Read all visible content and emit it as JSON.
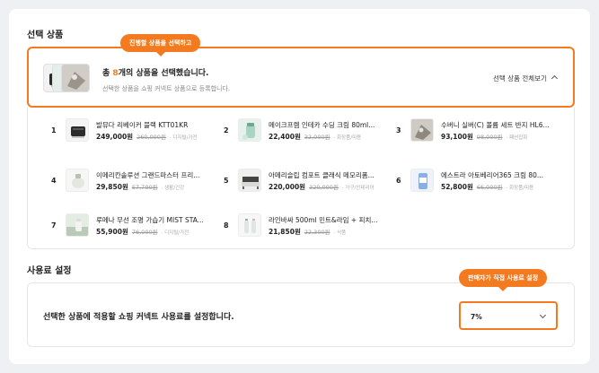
{
  "selected_products": {
    "section_title": "선택 상품",
    "tooltip": "진행할 상품을 선택하고",
    "summary_prefix": "총 ",
    "summary_count": "8",
    "summary_suffix": "개의 상품을 선택했습니다.",
    "summary_sub": "선택한 상품을 쇼핑 커넥트 상품으로 등록합니다.",
    "view_all": "선택 상품 전체보기",
    "products": [
      {
        "index": "1",
        "name": "발뮤다 리베이커 블랙 KTT01KR",
        "price": "249,000원",
        "original": "260,000원",
        "category": "디지털/가전"
      },
      {
        "index": "2",
        "name": "메이크프렘 인테카 수딩 크림 80ml...",
        "price": "22,400원",
        "original": "32,000원",
        "category": "화장품/미용"
      },
      {
        "index": "3",
        "name": "수버니 실버(C) 볼륨 세트 반지 HL6...",
        "price": "93,100원",
        "original": "98,000원",
        "category": "패션잡화"
      },
      {
        "index": "4",
        "name": "이메리칸솔루션 그랜드마스터 프리...",
        "price": "29,850원",
        "original": "57,700원",
        "category": "생활/건강"
      },
      {
        "index": "5",
        "name": "아메리슬립 컴포트 클래식 메모리폼...",
        "price": "220,000원",
        "original": "320,000원",
        "category": "가구/인테리어"
      },
      {
        "index": "6",
        "name": "에스트라 아토베리어365 크림 80...",
        "price": "52,800원",
        "original": "66,000원",
        "category": "화장품/미용"
      },
      {
        "index": "7",
        "name": "루메나 무선 조명 가습기 MIST STA...",
        "price": "55,900원",
        "original": "76,000원",
        "category": "디지털/가전"
      },
      {
        "index": "8",
        "name": "라인바싸 500ml 민트&라임 + 피치...",
        "price": "21,850원",
        "original": "22,300원",
        "category": "식품"
      }
    ]
  },
  "fee_settings": {
    "section_title": "사용료 설정",
    "tooltip": "판매자가 직접 사용료 설정",
    "description": "선택한 상품에 적용할 쇼핑 커넥트 사용료를 설정합니다.",
    "selected_value": "7%"
  },
  "colors": {
    "accent": "#f47a1f"
  }
}
